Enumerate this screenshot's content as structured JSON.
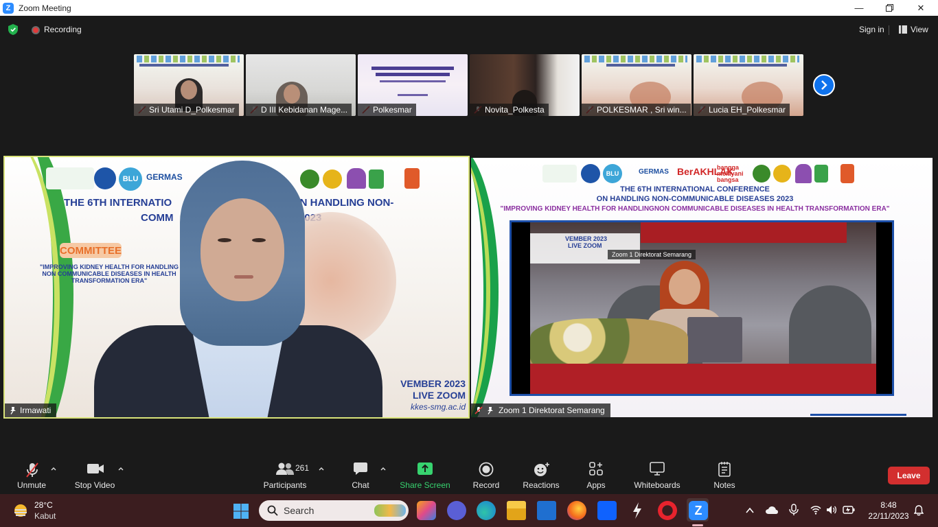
{
  "window": {
    "title": "Zoom Meeting"
  },
  "topbar": {
    "recording": "Recording",
    "sign_in": "Sign in",
    "view": "View"
  },
  "thumbnails": [
    {
      "name": "Sri Utami D_Polkesmar"
    },
    {
      "name": "D III Kebidanan Mage..."
    },
    {
      "name": "Polkesmar"
    },
    {
      "name": "Novita_Polkesta"
    },
    {
      "name": "POLKESMAR , Sri win..."
    },
    {
      "name": "Lucia EH_Polkesmar"
    }
  ],
  "left_tile": {
    "name": "Irmawati",
    "title_line1": "THE 6TH INTERNATIO",
    "title_line1b": "ON HANDLING NON-",
    "title_line2": "COMM",
    "title_line2b": "2023",
    "committee": "COMMITTEE",
    "theme1": "\"IMPROVING KIDNEY HEALTH FOR HANDLING",
    "theme2": "NON COMMUNICABLE DISEASES IN HEALTH",
    "theme3": "TRANSFORMATION ERA\"",
    "date": "VEMBER 2023",
    "live": "LIVE ZOOM",
    "site": "kkes-smg.ac.id",
    "logo_text1": "GERMAS",
    "logo_text2": "BLU"
  },
  "right_tile": {
    "name": "Zoom 1 Direktorat Semarang",
    "header1": "THE 6TH INTERNATIONAL CONFERENCE",
    "header2": "ON HANDLING NON-COMMUNICABLE DISEASES 2023",
    "theme": "\"IMPROVING KIDNEY HEALTH FOR HANDLINGNON COMMUNICABLE DISEASES IN HEALTH TRANSFORMATION ERA\"",
    "inner_date": "VEMBER 2023",
    "inner_live": "LIVE ZOOM",
    "inner_name": "Zoom 1 Direktorat Semarang",
    "logo_berakhlak": "BerAKHLAK",
    "logo_bangga": "bangga melayani bangsa",
    "logo_germas": "GERMAS",
    "logo_blu": "BLU"
  },
  "toolbar": {
    "unmute": "Unmute",
    "stop_video": "Stop Video",
    "participants": "Participants",
    "participants_count": "261",
    "chat": "Chat",
    "share_screen": "Share Screen",
    "record": "Record",
    "reactions": "Reactions",
    "apps": "Apps",
    "whiteboards": "Whiteboards",
    "notes": "Notes",
    "leave": "Leave"
  },
  "taskbar": {
    "weather_temp": "28°C",
    "weather_desc": "Kabut",
    "search": "Search",
    "time": "8:48",
    "date": "22/11/2023"
  },
  "colors": {
    "accent": "#0e72ed",
    "leave": "#d32f2f",
    "share": "#37d36f",
    "active_border": "#d9e37a"
  }
}
